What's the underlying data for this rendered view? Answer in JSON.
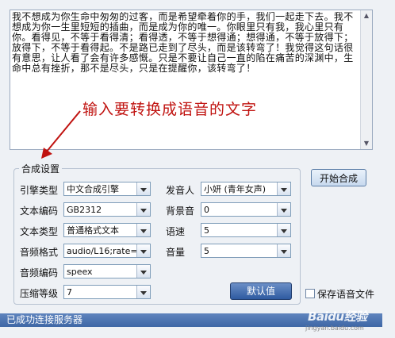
{
  "input_text": "我不想成为你生命中匆匆的过客，而是希望牵着你的手，我们一起走下去。我不想成为你一生里短短的插曲，而是成为你的唯一。你眼里只有我，我心里只有你。看得见，不等于看得清；看得透，不等于想得通；想得通，不等于放得下；放得下，不等于看得起。不是路已走到了尽头，而是该转弯了！我觉得这句话很有意思，让人看了会有许多感慨。只是不要让自己一直的陷在痛苦的深渊中，生命中总有挫折，那不是尽头，只是在提醒你，该转弯了！",
  "annotation_text": "输入要转换成语音的文字",
  "settings_group_title": "合成设置",
  "fields": {
    "engine_label": "引擎类型",
    "engine_value": "中文合成引擎",
    "speaker_label": "发音人",
    "speaker_value": "小妍 (青年女声)",
    "encoding_label": "文本编码",
    "encoding_value": "GB2312",
    "bgm_label": "背景音",
    "bgm_value": "0",
    "texttype_label": "文本类型",
    "texttype_value": "普通格式文本",
    "speed_label": "语速",
    "speed_value": "5",
    "audioformat_label": "音频格式",
    "audioformat_value": "audio/L16;rate=",
    "volume_label": "音量",
    "volume_value": "5",
    "audiocodec_label": "音频编码",
    "audiocodec_value": "speex",
    "compress_label": "压缩等级",
    "compress_value": "7"
  },
  "buttons": {
    "start_label": "开始合成",
    "default_label": "默认值"
  },
  "save_audio_label": "保存语音文件",
  "status_text": "已成功连接服务器",
  "watermark": {
    "logo": "Baidu经验",
    "url": "jingyan.baidu.com"
  },
  "colors": {
    "annotation_red": "#c0120f",
    "status_bar_blue": "#4a72b0",
    "default_button_blue": "#2e5aa0"
  }
}
